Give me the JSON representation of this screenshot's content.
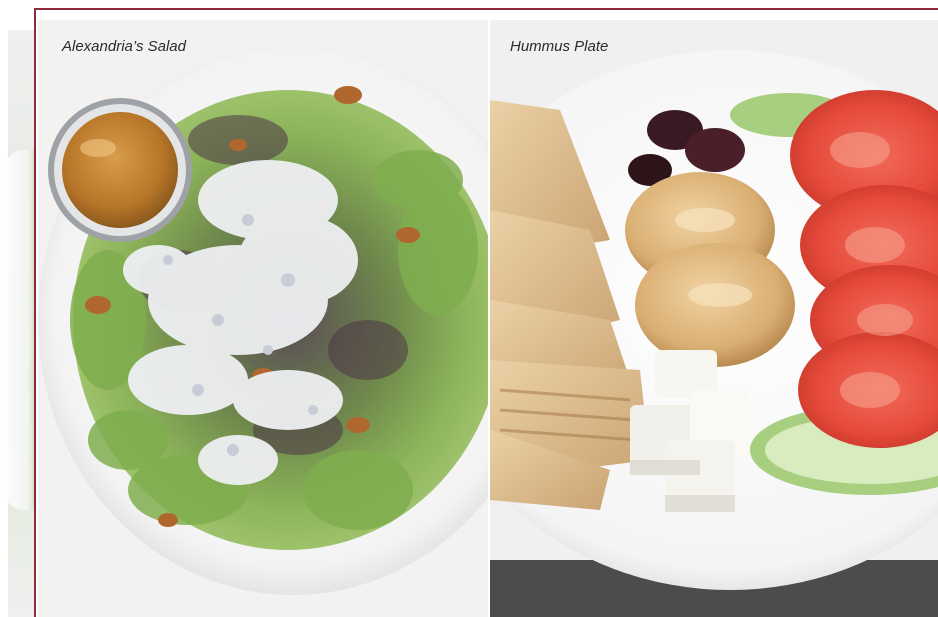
{
  "gallery": {
    "accent_color": "#8e2b3b",
    "items": [
      {
        "caption": "Alexandria’s Salad",
        "image": "salad-photo"
      },
      {
        "caption": "Hummus Plate",
        "image": "hummus-photo"
      }
    ]
  }
}
